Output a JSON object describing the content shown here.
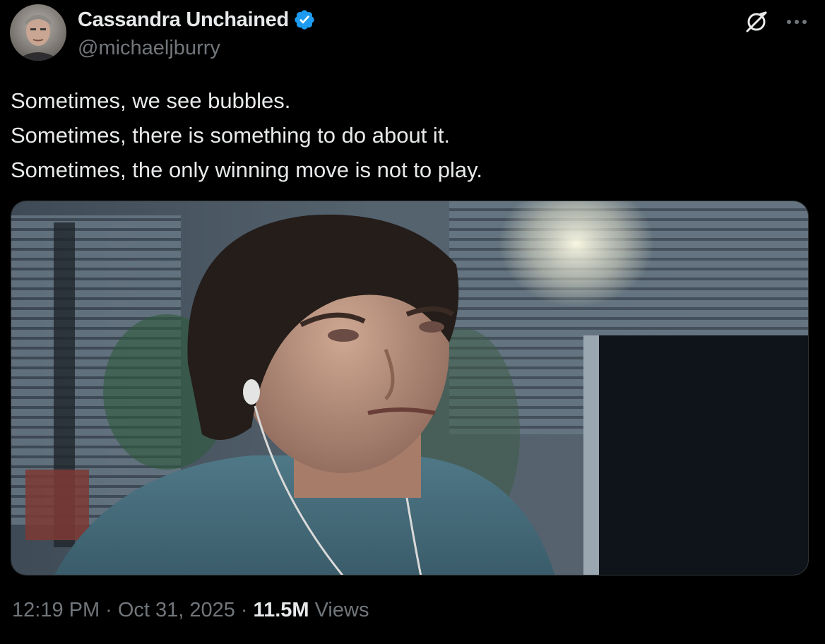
{
  "author": {
    "display_name": "Cassandra Unchained",
    "handle": "@michaeljburry",
    "verified": true,
    "avatar_icon": "profile-photo"
  },
  "header_actions": {
    "grok_icon": "grok-icon",
    "more_icon": "more-icon"
  },
  "tweet": {
    "lines": [
      "Sometimes, we see bubbles.",
      "Sometimes, there is something to do about it.",
      "Sometimes, the only winning move is not to play."
    ],
    "media": {
      "alt": "Film still of a man with earphones looking at a computer screen in an office"
    }
  },
  "meta": {
    "time": "12:19 PM",
    "separator": "·",
    "date": "Oct 31, 2025",
    "views_count": "11.5M",
    "views_label": "Views"
  },
  "colors": {
    "background": "#000000",
    "text_primary": "#e7e9ea",
    "text_secondary": "#71767b",
    "verified_badge": "#1d9bf0"
  }
}
